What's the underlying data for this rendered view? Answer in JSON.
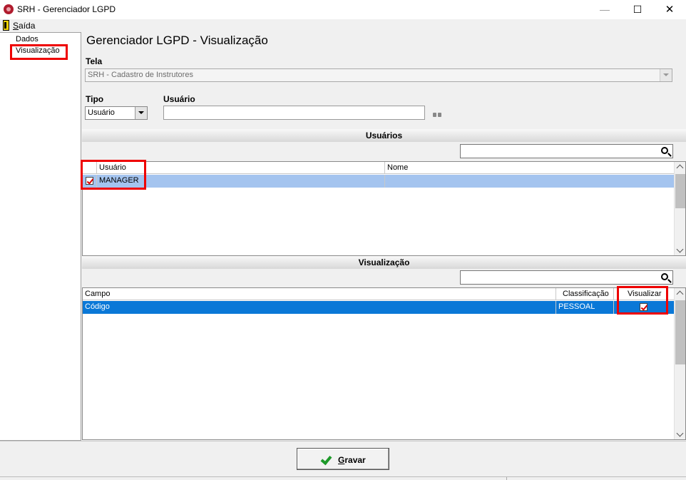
{
  "window": {
    "title": "SRH - Gerenciador LGPD",
    "minimize_glyph": "—",
    "maximize_glyph": "☐",
    "close_glyph": "✕"
  },
  "menu": {
    "exit_first": "S",
    "exit_rest": "aída"
  },
  "nav": {
    "items": [
      {
        "label": "Dados"
      },
      {
        "label": "Visualização"
      }
    ]
  },
  "main": {
    "title": "Gerenciador LGPD - Visualização",
    "tela_label": "Tela",
    "tela_value": "SRH - Cadastro de Instrutores",
    "tipo_label": "Tipo",
    "tipo_value": "Usuário",
    "usuario_label": "Usuário",
    "usuario_value": ""
  },
  "usuarios": {
    "header": "Usuários",
    "search_value": "",
    "columns": [
      "Usuário",
      "Nome"
    ],
    "rows": [
      {
        "checked": true,
        "usuario": "MANAGER",
        "nome": ""
      }
    ]
  },
  "visualizacao": {
    "header": "Visualização",
    "search_value": "",
    "columns": [
      "Campo",
      "Classificação",
      "Visualizar"
    ],
    "rows": [
      {
        "campo": "Código",
        "classificacao": "PESSOAL",
        "visualizar": true
      }
    ]
  },
  "footer": {
    "save_first": "G",
    "save_rest": "ravar"
  },
  "colors": {
    "highlight_red": "#e00000",
    "selected_row_blue": "#0a78d7",
    "pale_row_blue": "#a4c4ef",
    "check_green": "#1e9a2a"
  },
  "icons": [
    "app-icon",
    "exit-icon",
    "binoculars-icon",
    "search-icon",
    "check-icon"
  ]
}
